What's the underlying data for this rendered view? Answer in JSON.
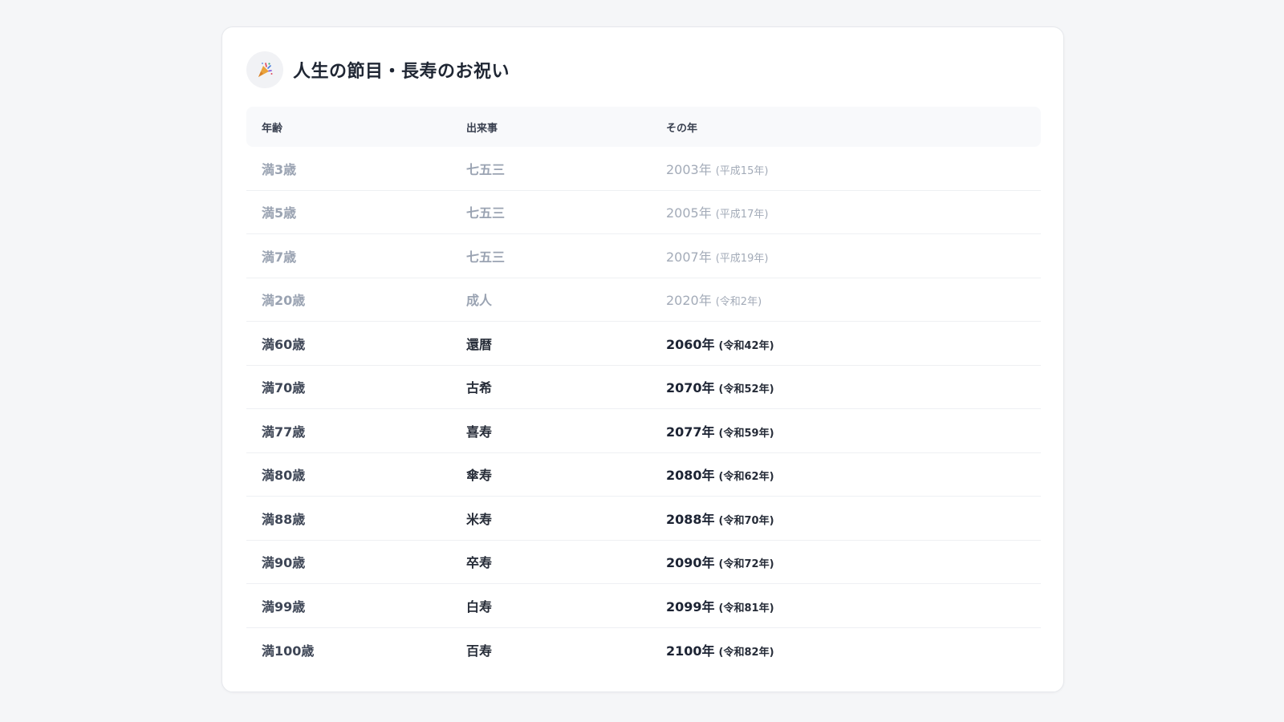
{
  "title": "人生の節目・長寿のお祝い",
  "icon": "party-popper-icon",
  "headers": [
    "年齢",
    "出来事",
    "その年"
  ],
  "rows": [
    {
      "age": "満3歳",
      "event": "七五三",
      "year": "2003年",
      "era": "(平成15年)",
      "state": "past"
    },
    {
      "age": "満5歳",
      "event": "七五三",
      "year": "2005年",
      "era": "(平成17年)",
      "state": "past"
    },
    {
      "age": "満7歳",
      "event": "七五三",
      "year": "2007年",
      "era": "(平成19年)",
      "state": "past"
    },
    {
      "age": "満20歳",
      "event": "成人",
      "year": "2020年",
      "era": "(令和2年)",
      "state": "past"
    },
    {
      "age": "満60歳",
      "event": "還暦",
      "year": "2060年",
      "era": "(令和42年)",
      "state": "future"
    },
    {
      "age": "満70歳",
      "event": "古希",
      "year": "2070年",
      "era": "(令和52年)",
      "state": "future"
    },
    {
      "age": "満77歳",
      "event": "喜寿",
      "year": "2077年",
      "era": "(令和59年)",
      "state": "future"
    },
    {
      "age": "満80歳",
      "event": "傘寿",
      "year": "2080年",
      "era": "(令和62年)",
      "state": "future"
    },
    {
      "age": "満88歳",
      "event": "米寿",
      "year": "2088年",
      "era": "(令和70年)",
      "state": "future"
    },
    {
      "age": "満90歳",
      "event": "卒寿",
      "year": "2090年",
      "era": "(令和72年)",
      "state": "future"
    },
    {
      "age": "満99歳",
      "event": "白寿",
      "year": "2099年",
      "era": "(令和81年)",
      "state": "future"
    },
    {
      "age": "満100歳",
      "event": "百寿",
      "year": "2100年",
      "era": "(令和82年)",
      "state": "future"
    }
  ],
  "colors": {
    "past_text": "#9aa3b2",
    "future_text": "#262c38",
    "header_bg": "#f8f9fb",
    "page_bg": "#f5f6f8"
  }
}
